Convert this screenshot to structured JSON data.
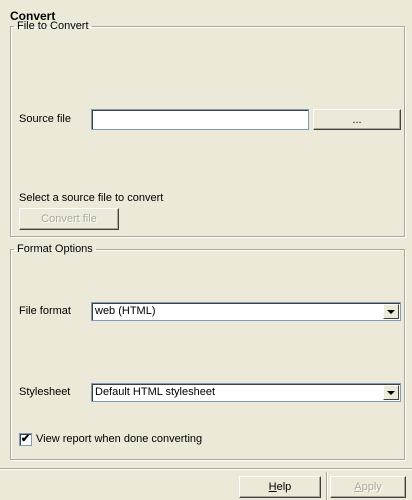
{
  "dialog": {
    "title": "Convert"
  },
  "file_group": {
    "legend": "File to Convert",
    "source_label": "Source file",
    "source_value": "",
    "browse_label": "...",
    "status_text": "Select a source file to convert",
    "convert_label": "Convert file"
  },
  "format_group": {
    "legend": "Format Options",
    "format_label": "File format",
    "format_value": "web (HTML)",
    "stylesheet_label": "Stylesheet",
    "stylesheet_value": "Default HTML stylesheet",
    "view_report_checked": true,
    "view_report_label": "View report when done converting"
  },
  "footer": {
    "help_mnemonic": "H",
    "help_rest": "elp",
    "apply_mnemonic": "A",
    "apply_rest": "pply"
  }
}
